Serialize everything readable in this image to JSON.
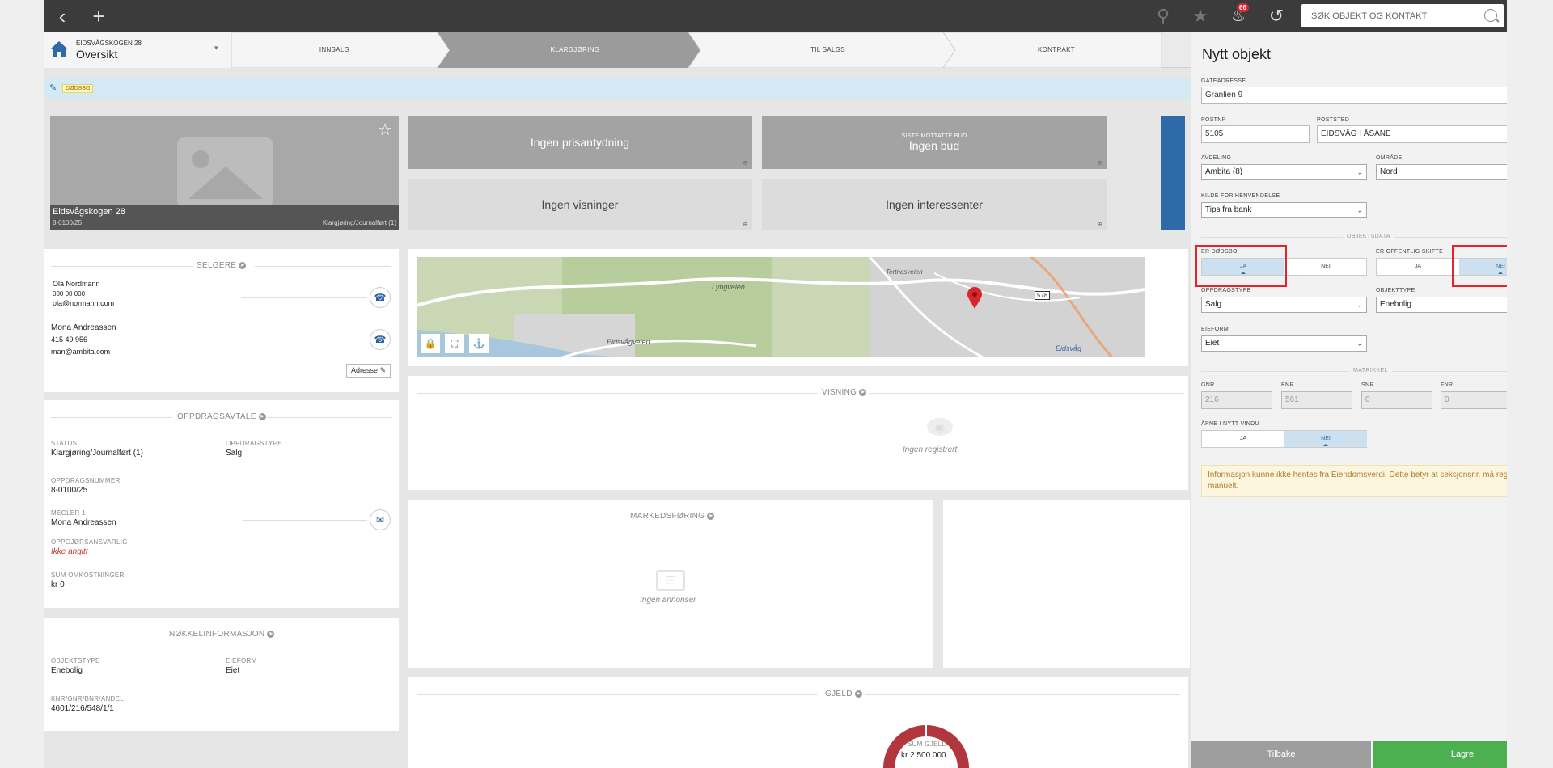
{
  "search": {
    "placeholder": "SØK OBJEKT OG KONTAKT"
  },
  "notifications": {
    "count": "66"
  },
  "property": {
    "address": "EIDSVÅGSKOGEN 28",
    "title": "Oversikt"
  },
  "steps": [
    "INNSALG",
    "KLARGJØRING",
    "TIL SALGS",
    "KONTRAKT"
  ],
  "tag": "DØDSBO",
  "photo": {
    "title": "Eidsvågskogen 28",
    "id": "8-0100/25",
    "status": "Klargjøring/Journalført (1)"
  },
  "tiles": {
    "prisantydning": "Ingen prisantydning",
    "bud_label": "SISTE MOTTATTE BUD",
    "bud": "Ingen bud",
    "visninger": "Ingen visninger",
    "interessenter": "Ingen interessenter"
  },
  "sellers": {
    "heading": "SELGERE",
    "list": [
      {
        "name": "Ola Nordmann",
        "phone": "000 00 000",
        "email": "ola@normann.com"
      },
      {
        "name": "Mona Andreassen",
        "phone": "415 49 956",
        "email": "man@ambita.com"
      }
    ],
    "address_button": "Adresse"
  },
  "assignment": {
    "heading": "OPPDRAGSAVTALE",
    "status_label": "STATUS",
    "status": "Klargjøring/Journalført (1)",
    "type_label": "OPPDRAGSTYPE",
    "type": "Salg",
    "number_label": "OPPDRAGSNUMMER",
    "number": "8-0100/25",
    "broker_label": "MEGLER 1",
    "broker": "Mona Andreassen",
    "settlement_label": "OPPGJØRSANSVARLIG",
    "settlement": "Ikke angitt",
    "costs_label": "SUM OMKOSTNINGER",
    "costs": "kr 0"
  },
  "keyinfo": {
    "heading": "NØKKELINFORMASJON",
    "objtype_label": "OBJEKTSTYPE",
    "objtype": "Enebolig",
    "ownership_label": "EIEFORM",
    "ownership": "Eiet",
    "knr_label": "KNR/GNR/BNR/ANDEL",
    "knr": "4601/216/548/1/1"
  },
  "map": {
    "labels": [
      "Lyngveien",
      "Eidsvågveien",
      "Tertnesveien",
      "Eidsvåg",
      "578"
    ]
  },
  "viewing": {
    "heading": "VISNING",
    "empty": "Ingen registrert"
  },
  "marketing": {
    "heading": "MARKEDSFØRING",
    "empty": "Ingen annonser"
  },
  "debt": {
    "heading": "GJELD",
    "label": "SUM GJELD",
    "value": "kr 2 500 000"
  },
  "panel": {
    "title": "Nytt objekt",
    "street_label": "GATEADRESSE",
    "street": "Granlien 9",
    "postnr_label": "POSTNR",
    "postnr": "5105",
    "poststed_label": "POSTSTED",
    "poststed": "EIDSVÅG I ÅSANE",
    "dept_label": "AVDELING",
    "dept": "Ambita (8)",
    "area_label": "OMRÅDE",
    "area": "Nord",
    "source_label": "KILDE FOR HENVENDELSE",
    "source": "Tips fra bank",
    "objdata_title": "OBJEKTSDATA",
    "dodsbo_label": "ER DØDSBO",
    "skifte_label": "ER OFFENTLIG SKIFTE",
    "yes": "JA",
    "no": "NEI",
    "assign_type_label": "OPPDRAGSTYPE",
    "assign_type": "Salg",
    "obj_type_label": "OBJEKTTYPE",
    "obj_type": "Enebolig",
    "ownership_label": "EIEFORM",
    "ownership": "Eiet",
    "matrikkel_title": "MATRIKKEL",
    "gnr_label": "GNR",
    "gnr": "216",
    "bnr_label": "BNR",
    "bnr": "561",
    "snr_label": "SNR",
    "snr": "0",
    "fnr_label": "FNR",
    "fnr": "0",
    "open_label": "ÅPNE I NYTT VINDU",
    "warning": "Informasjon kunne ikke hentes fra Eiendomsverdi. Dette betyr at seksjonsnr. må registreres manuelt.",
    "back": "Tilbake",
    "save": "Lagre"
  },
  "colors": {
    "accent": "#2e6aa8",
    "save": "#4caf50",
    "back": "#9e9e9e",
    "highlight": "#e3262c"
  }
}
